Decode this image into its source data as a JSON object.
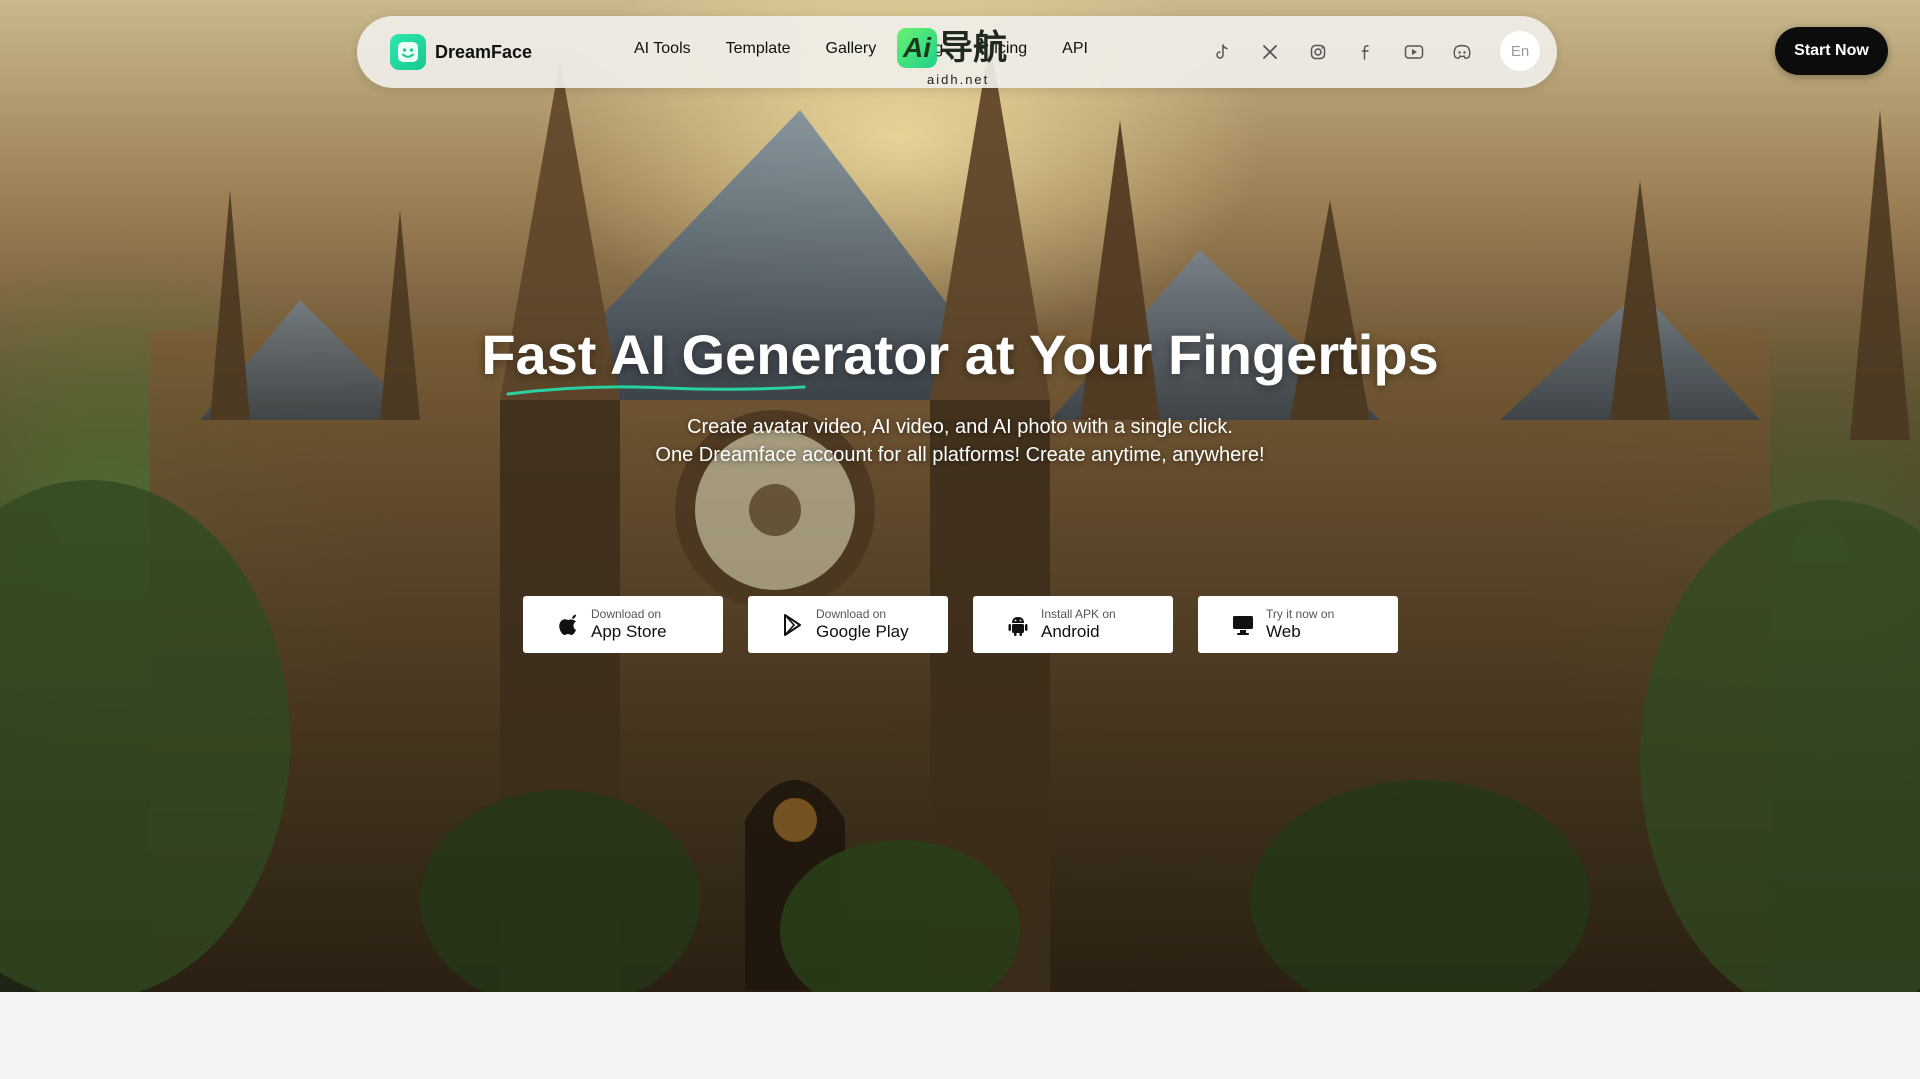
{
  "brand": {
    "name": "DreamFace"
  },
  "nav": {
    "items": [
      {
        "label": "AI Tools"
      },
      {
        "label": "Template"
      },
      {
        "label": "Gallery"
      },
      {
        "label": "Blog"
      },
      {
        "label": "Pricing"
      },
      {
        "label": "API"
      }
    ]
  },
  "social": {
    "icons": [
      "tiktok-icon",
      "x-icon",
      "instagram-icon",
      "facebook-icon",
      "youtube-icon",
      "discord-icon"
    ]
  },
  "language": {
    "label": "En"
  },
  "cta": {
    "label": "Start Now"
  },
  "watermark": {
    "badge": "Ai",
    "text": "导航",
    "sub": "aidh.net"
  },
  "hero": {
    "title": "Fast AI Generator at Your Fingertips",
    "subtitle_1": "Create avatar video, AI video, and AI photo with a single click.",
    "subtitle_2": "One Dreamface account for all platforms! Create anytime, anywhere!"
  },
  "downloads": [
    {
      "small": "Download on",
      "big": "App Store",
      "icon": "apple-icon"
    },
    {
      "small": "Download on",
      "big": "Google Play",
      "icon": "google-play-icon"
    },
    {
      "small": "Install APK on",
      "big": "Android",
      "icon": "android-icon"
    },
    {
      "small": "Try it now on",
      "big": "Web",
      "icon": "desktop-icon"
    }
  ],
  "colors": {
    "accent": "#1fd08d",
    "cta_bg": "#0c0c0c",
    "page_bg": "#f4f4f4"
  }
}
